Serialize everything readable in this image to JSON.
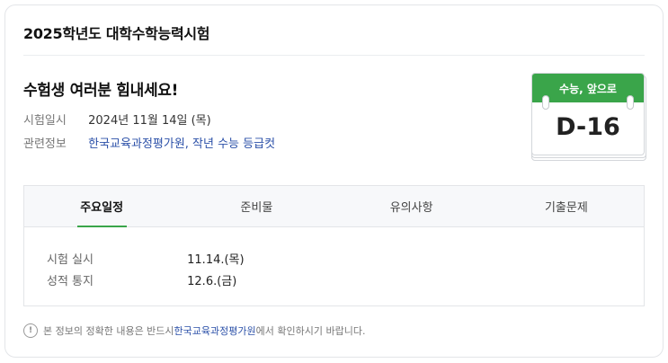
{
  "card": {
    "title": "2025학년도 대학수학능력시험"
  },
  "headline": "수험생 여러분 힘내세요!",
  "info": {
    "date_label": "시험일시",
    "date_value": "2024년 11월 14일 (목)",
    "related_label": "관련정보",
    "related_links": "한국교육과정평가원, 작년 수능 등급컷"
  },
  "calendar": {
    "header": "수능, 앞으로",
    "dday": "D-16",
    "accent_color": "#3aa54a"
  },
  "tabs": [
    {
      "label": "주요일정",
      "active": true
    },
    {
      "label": "준비물",
      "active": false
    },
    {
      "label": "유의사항",
      "active": false
    },
    {
      "label": "기출문제",
      "active": false
    }
  ],
  "schedule": [
    {
      "label": "시험 실시",
      "value": "11.14.(목)"
    },
    {
      "label": "성적 통지",
      "value": "12.6.(금)"
    }
  ],
  "note": {
    "icon": "exclamation-circle-icon",
    "prefix": "본 정보의 정확한 내용은 반드시 ",
    "link": "한국교육과정평가원",
    "suffix": "에서 확인하시기 바랍니다."
  }
}
